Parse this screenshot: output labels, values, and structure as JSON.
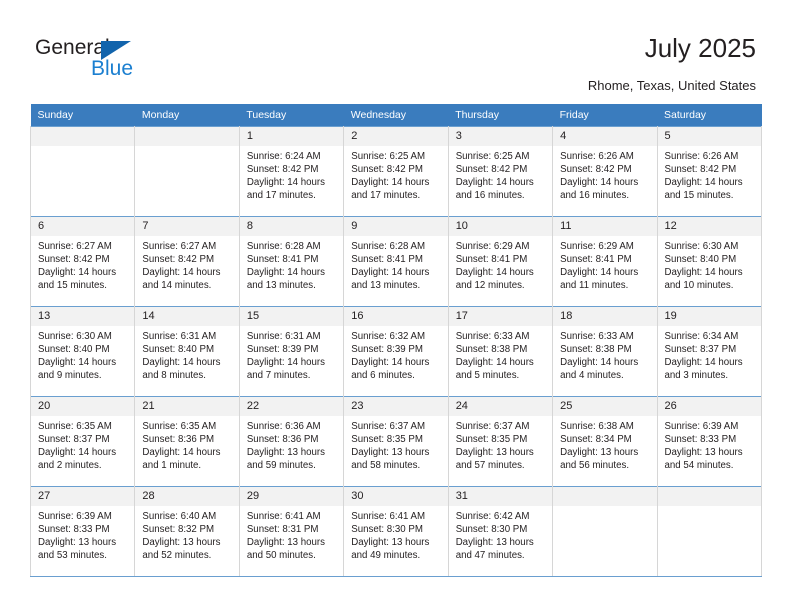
{
  "brand": {
    "name_top": "General",
    "name_bottom": "Blue",
    "accent_color": "#1b7fd0",
    "triangle_color": "#1264ac",
    "triangle_icon": "triangle-icon"
  },
  "header": {
    "title": "July 2025",
    "subtitle": "Rhome, Texas, United States"
  },
  "theme": {
    "header_row_bg": "#3a7cbe",
    "day_number_bg": "#f2f2f2",
    "cell_border": "#d6d6d6",
    "week_border": "#6a9fd0",
    "text": "#231f20"
  },
  "calendar": {
    "weekday_headers": [
      "Sunday",
      "Monday",
      "Tuesday",
      "Wednesday",
      "Thursday",
      "Friday",
      "Saturday"
    ],
    "labels": {
      "sunrise": "Sunrise:",
      "sunset": "Sunset:",
      "daylight": "Daylight:"
    },
    "weeks": [
      [
        {
          "day": "",
          "empty": true
        },
        {
          "day": "",
          "empty": true
        },
        {
          "day": "1",
          "sunrise": "Sunrise: 6:24 AM",
          "sunset": "Sunset: 8:42 PM",
          "daylight_line1": "Daylight: 14 hours",
          "daylight_line2": "and 17 minutes."
        },
        {
          "day": "2",
          "sunrise": "Sunrise: 6:25 AM",
          "sunset": "Sunset: 8:42 PM",
          "daylight_line1": "Daylight: 14 hours",
          "daylight_line2": "and 17 minutes."
        },
        {
          "day": "3",
          "sunrise": "Sunrise: 6:25 AM",
          "sunset": "Sunset: 8:42 PM",
          "daylight_line1": "Daylight: 14 hours",
          "daylight_line2": "and 16 minutes."
        },
        {
          "day": "4",
          "sunrise": "Sunrise: 6:26 AM",
          "sunset": "Sunset: 8:42 PM",
          "daylight_line1": "Daylight: 14 hours",
          "daylight_line2": "and 16 minutes."
        },
        {
          "day": "5",
          "sunrise": "Sunrise: 6:26 AM",
          "sunset": "Sunset: 8:42 PM",
          "daylight_line1": "Daylight: 14 hours",
          "daylight_line2": "and 15 minutes."
        }
      ],
      [
        {
          "day": "6",
          "sunrise": "Sunrise: 6:27 AM",
          "sunset": "Sunset: 8:42 PM",
          "daylight_line1": "Daylight: 14 hours",
          "daylight_line2": "and 15 minutes."
        },
        {
          "day": "7",
          "sunrise": "Sunrise: 6:27 AM",
          "sunset": "Sunset: 8:42 PM",
          "daylight_line1": "Daylight: 14 hours",
          "daylight_line2": "and 14 minutes."
        },
        {
          "day": "8",
          "sunrise": "Sunrise: 6:28 AM",
          "sunset": "Sunset: 8:41 PM",
          "daylight_line1": "Daylight: 14 hours",
          "daylight_line2": "and 13 minutes."
        },
        {
          "day": "9",
          "sunrise": "Sunrise: 6:28 AM",
          "sunset": "Sunset: 8:41 PM",
          "daylight_line1": "Daylight: 14 hours",
          "daylight_line2": "and 13 minutes."
        },
        {
          "day": "10",
          "sunrise": "Sunrise: 6:29 AM",
          "sunset": "Sunset: 8:41 PM",
          "daylight_line1": "Daylight: 14 hours",
          "daylight_line2": "and 12 minutes."
        },
        {
          "day": "11",
          "sunrise": "Sunrise: 6:29 AM",
          "sunset": "Sunset: 8:41 PM",
          "daylight_line1": "Daylight: 14 hours",
          "daylight_line2": "and 11 minutes."
        },
        {
          "day": "12",
          "sunrise": "Sunrise: 6:30 AM",
          "sunset": "Sunset: 8:40 PM",
          "daylight_line1": "Daylight: 14 hours",
          "daylight_line2": "and 10 minutes."
        }
      ],
      [
        {
          "day": "13",
          "sunrise": "Sunrise: 6:30 AM",
          "sunset": "Sunset: 8:40 PM",
          "daylight_line1": "Daylight: 14 hours",
          "daylight_line2": "and 9 minutes."
        },
        {
          "day": "14",
          "sunrise": "Sunrise: 6:31 AM",
          "sunset": "Sunset: 8:40 PM",
          "daylight_line1": "Daylight: 14 hours",
          "daylight_line2": "and 8 minutes."
        },
        {
          "day": "15",
          "sunrise": "Sunrise: 6:31 AM",
          "sunset": "Sunset: 8:39 PM",
          "daylight_line1": "Daylight: 14 hours",
          "daylight_line2": "and 7 minutes."
        },
        {
          "day": "16",
          "sunrise": "Sunrise: 6:32 AM",
          "sunset": "Sunset: 8:39 PM",
          "daylight_line1": "Daylight: 14 hours",
          "daylight_line2": "and 6 minutes."
        },
        {
          "day": "17",
          "sunrise": "Sunrise: 6:33 AM",
          "sunset": "Sunset: 8:38 PM",
          "daylight_line1": "Daylight: 14 hours",
          "daylight_line2": "and 5 minutes."
        },
        {
          "day": "18",
          "sunrise": "Sunrise: 6:33 AM",
          "sunset": "Sunset: 8:38 PM",
          "daylight_line1": "Daylight: 14 hours",
          "daylight_line2": "and 4 minutes."
        },
        {
          "day": "19",
          "sunrise": "Sunrise: 6:34 AM",
          "sunset": "Sunset: 8:37 PM",
          "daylight_line1": "Daylight: 14 hours",
          "daylight_line2": "and 3 minutes."
        }
      ],
      [
        {
          "day": "20",
          "sunrise": "Sunrise: 6:35 AM",
          "sunset": "Sunset: 8:37 PM",
          "daylight_line1": "Daylight: 14 hours",
          "daylight_line2": "and 2 minutes."
        },
        {
          "day": "21",
          "sunrise": "Sunrise: 6:35 AM",
          "sunset": "Sunset: 8:36 PM",
          "daylight_line1": "Daylight: 14 hours",
          "daylight_line2": "and 1 minute."
        },
        {
          "day": "22",
          "sunrise": "Sunrise: 6:36 AM",
          "sunset": "Sunset: 8:36 PM",
          "daylight_line1": "Daylight: 13 hours",
          "daylight_line2": "and 59 minutes."
        },
        {
          "day": "23",
          "sunrise": "Sunrise: 6:37 AM",
          "sunset": "Sunset: 8:35 PM",
          "daylight_line1": "Daylight: 13 hours",
          "daylight_line2": "and 58 minutes."
        },
        {
          "day": "24",
          "sunrise": "Sunrise: 6:37 AM",
          "sunset": "Sunset: 8:35 PM",
          "daylight_line1": "Daylight: 13 hours",
          "daylight_line2": "and 57 minutes."
        },
        {
          "day": "25",
          "sunrise": "Sunrise: 6:38 AM",
          "sunset": "Sunset: 8:34 PM",
          "daylight_line1": "Daylight: 13 hours",
          "daylight_line2": "and 56 minutes."
        },
        {
          "day": "26",
          "sunrise": "Sunrise: 6:39 AM",
          "sunset": "Sunset: 8:33 PM",
          "daylight_line1": "Daylight: 13 hours",
          "daylight_line2": "and 54 minutes."
        }
      ],
      [
        {
          "day": "27",
          "sunrise": "Sunrise: 6:39 AM",
          "sunset": "Sunset: 8:33 PM",
          "daylight_line1": "Daylight: 13 hours",
          "daylight_line2": "and 53 minutes."
        },
        {
          "day": "28",
          "sunrise": "Sunrise: 6:40 AM",
          "sunset": "Sunset: 8:32 PM",
          "daylight_line1": "Daylight: 13 hours",
          "daylight_line2": "and 52 minutes."
        },
        {
          "day": "29",
          "sunrise": "Sunrise: 6:41 AM",
          "sunset": "Sunset: 8:31 PM",
          "daylight_line1": "Daylight: 13 hours",
          "daylight_line2": "and 50 minutes."
        },
        {
          "day": "30",
          "sunrise": "Sunrise: 6:41 AM",
          "sunset": "Sunset: 8:30 PM",
          "daylight_line1": "Daylight: 13 hours",
          "daylight_line2": "and 49 minutes."
        },
        {
          "day": "31",
          "sunrise": "Sunrise: 6:42 AM",
          "sunset": "Sunset: 8:30 PM",
          "daylight_line1": "Daylight: 13 hours",
          "daylight_line2": "and 47 minutes."
        },
        {
          "day": "",
          "empty": true
        },
        {
          "day": "",
          "empty": true
        }
      ]
    ]
  }
}
